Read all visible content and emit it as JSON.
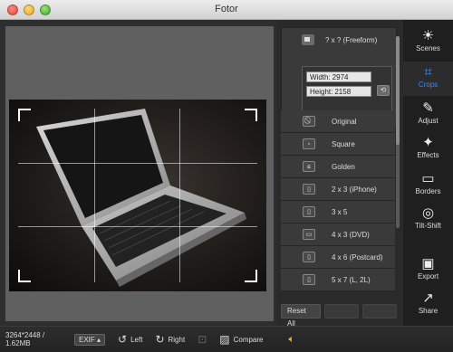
{
  "window": {
    "title": "Fotor"
  },
  "freeform": {
    "label": "? x ?  (Freeform)",
    "width_label": "Width:",
    "width_value": "2974",
    "height_label": "Height:",
    "height_value": "2158"
  },
  "crop_options": [
    {
      "label": "Original",
      "icon": "no-icon"
    },
    {
      "label": "Square",
      "icon": "square-icon"
    },
    {
      "label": "Golden",
      "icon": "spiral-icon"
    },
    {
      "label": "2 x 3  (iPhone)",
      "icon": "portrait-icon"
    },
    {
      "label": "3 x 5",
      "icon": "portrait-icon"
    },
    {
      "label": "4 x 3  (DVD)",
      "icon": "landscape-icon"
    },
    {
      "label": "4 x 6  (Postcard)",
      "icon": "portrait-icon"
    },
    {
      "label": "5 x 7  (L, 2L)",
      "icon": "portrait-icon"
    }
  ],
  "panel": {
    "reset_all": "Reset All"
  },
  "toolbar": [
    {
      "label": "Scenes",
      "glyph": "☀",
      "icon": "sun-icon"
    },
    {
      "label": "Crops",
      "glyph": "⌗",
      "icon": "crop-icon",
      "active": true
    },
    {
      "label": "Adjust",
      "glyph": "✎",
      "icon": "pencil-icon"
    },
    {
      "label": "Effects",
      "glyph": "✦",
      "icon": "sparkle-icon"
    },
    {
      "label": "Borders",
      "glyph": "▭",
      "icon": "frame-icon"
    },
    {
      "label": "Tilt-Shift",
      "glyph": "◎",
      "icon": "target-icon"
    },
    {
      "label": "Export",
      "glyph": "▣",
      "icon": "export-icon"
    },
    {
      "label": "Share",
      "glyph": "↗",
      "icon": "share-icon"
    }
  ],
  "bottom": {
    "info": "3264*2448 / 1.62MB",
    "exif": "EXIF ▴",
    "left": "Left",
    "right": "Right",
    "compare": "Compare"
  },
  "colors": {
    "accent": "#3b8bff",
    "volume": "#e6b422"
  }
}
